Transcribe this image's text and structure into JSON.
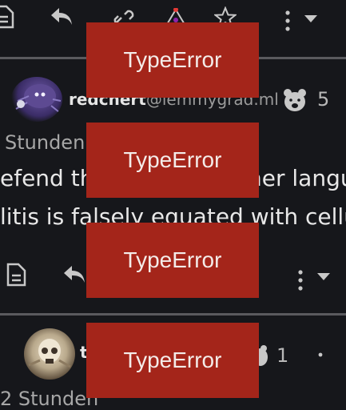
{
  "post1": {
    "username": "redchert",
    "instance": "@lemmygrad.ml",
    "vote_count": "5",
    "time": "Stunden",
    "body_line1_a": "efend th",
    "body_line1_b": "her langu",
    "body_line2": "litis is falsely equated with cellu"
  },
  "post2": {
    "username_initial": "t",
    "vote_count": "1",
    "time": "2 Stunden"
  },
  "errors": {
    "error1": "TypeError",
    "error2": "TypeError",
    "error3": "TypeError",
    "error4": "TypeError"
  },
  "icons": {
    "document": "document-icon",
    "reply": "reply-icon",
    "link": "link-icon",
    "crosspost": "crosspost-icon",
    "star": "star-icon",
    "more": "more-vertical-icon",
    "dropdown": "chevron-down-icon",
    "bear": "bear-icon"
  }
}
